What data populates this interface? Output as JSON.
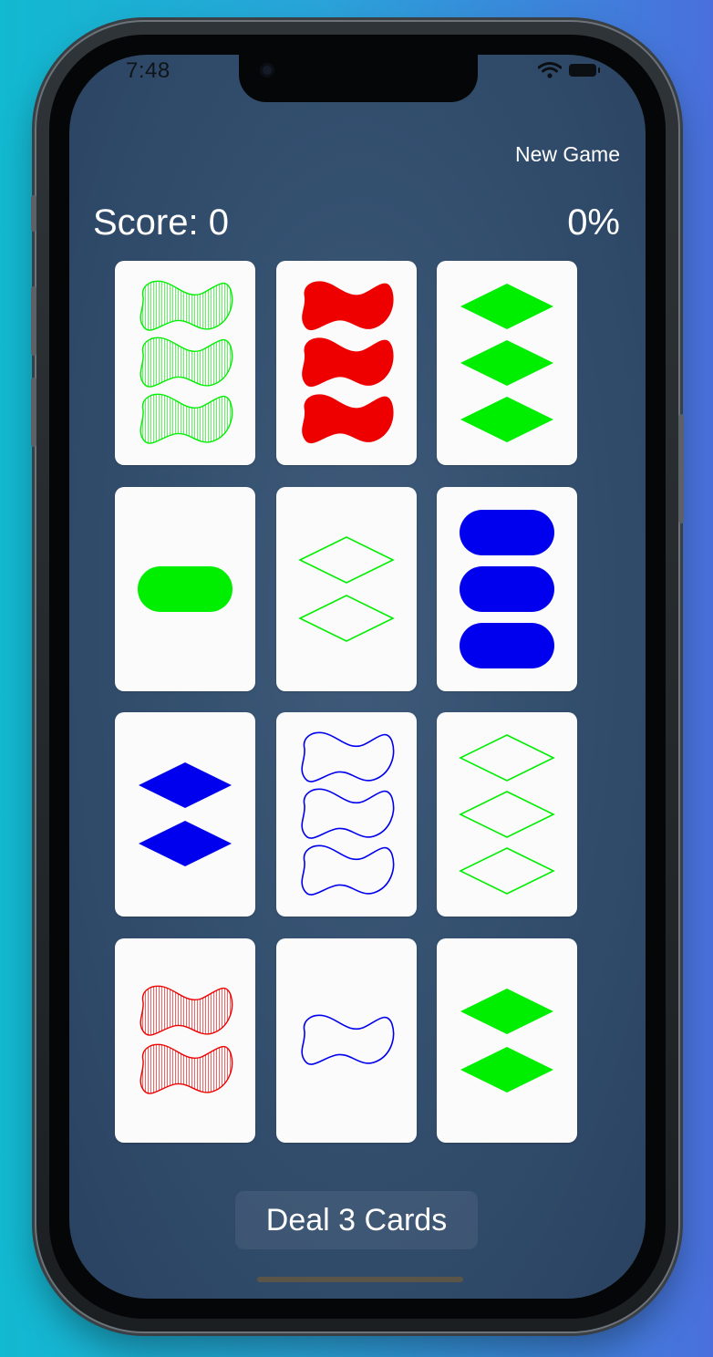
{
  "status_bar": {
    "time": "7:48",
    "icons": [
      "wifi-icon",
      "battery-icon"
    ]
  },
  "toolbar": {
    "new_game_label": "New Game"
  },
  "header": {
    "score_text": "Score: 0",
    "progress_text": "0%"
  },
  "colors": {
    "background_gradient": [
      "#12b9d0",
      "#4a6fdc"
    ],
    "screen": "#34506f",
    "card": "#fbfbfb",
    "symbol_green": "#00ee00",
    "symbol_red": "#ee0000",
    "symbol_blue": "#0000ee"
  },
  "cards": [
    {
      "count": 3,
      "shape": "squiggle",
      "shading": "striped",
      "color": "green"
    },
    {
      "count": 3,
      "shape": "squiggle",
      "shading": "solid",
      "color": "red"
    },
    {
      "count": 3,
      "shape": "diamond",
      "shading": "solid",
      "color": "green"
    },
    {
      "count": 1,
      "shape": "oval",
      "shading": "solid",
      "color": "green"
    },
    {
      "count": 2,
      "shape": "diamond",
      "shading": "open",
      "color": "green"
    },
    {
      "count": 3,
      "shape": "oval",
      "shading": "solid",
      "color": "blue"
    },
    {
      "count": 2,
      "shape": "diamond",
      "shading": "solid",
      "color": "blue"
    },
    {
      "count": 3,
      "shape": "squiggle",
      "shading": "open",
      "color": "blue"
    },
    {
      "count": 3,
      "shape": "diamond",
      "shading": "open",
      "color": "green"
    },
    {
      "count": 2,
      "shape": "squiggle",
      "shading": "striped",
      "color": "red"
    },
    {
      "count": 1,
      "shape": "squiggle",
      "shading": "open",
      "color": "blue"
    },
    {
      "count": 2,
      "shape": "diamond",
      "shading": "solid",
      "color": "green"
    }
  ],
  "footer": {
    "deal_label": "Deal 3 Cards"
  }
}
